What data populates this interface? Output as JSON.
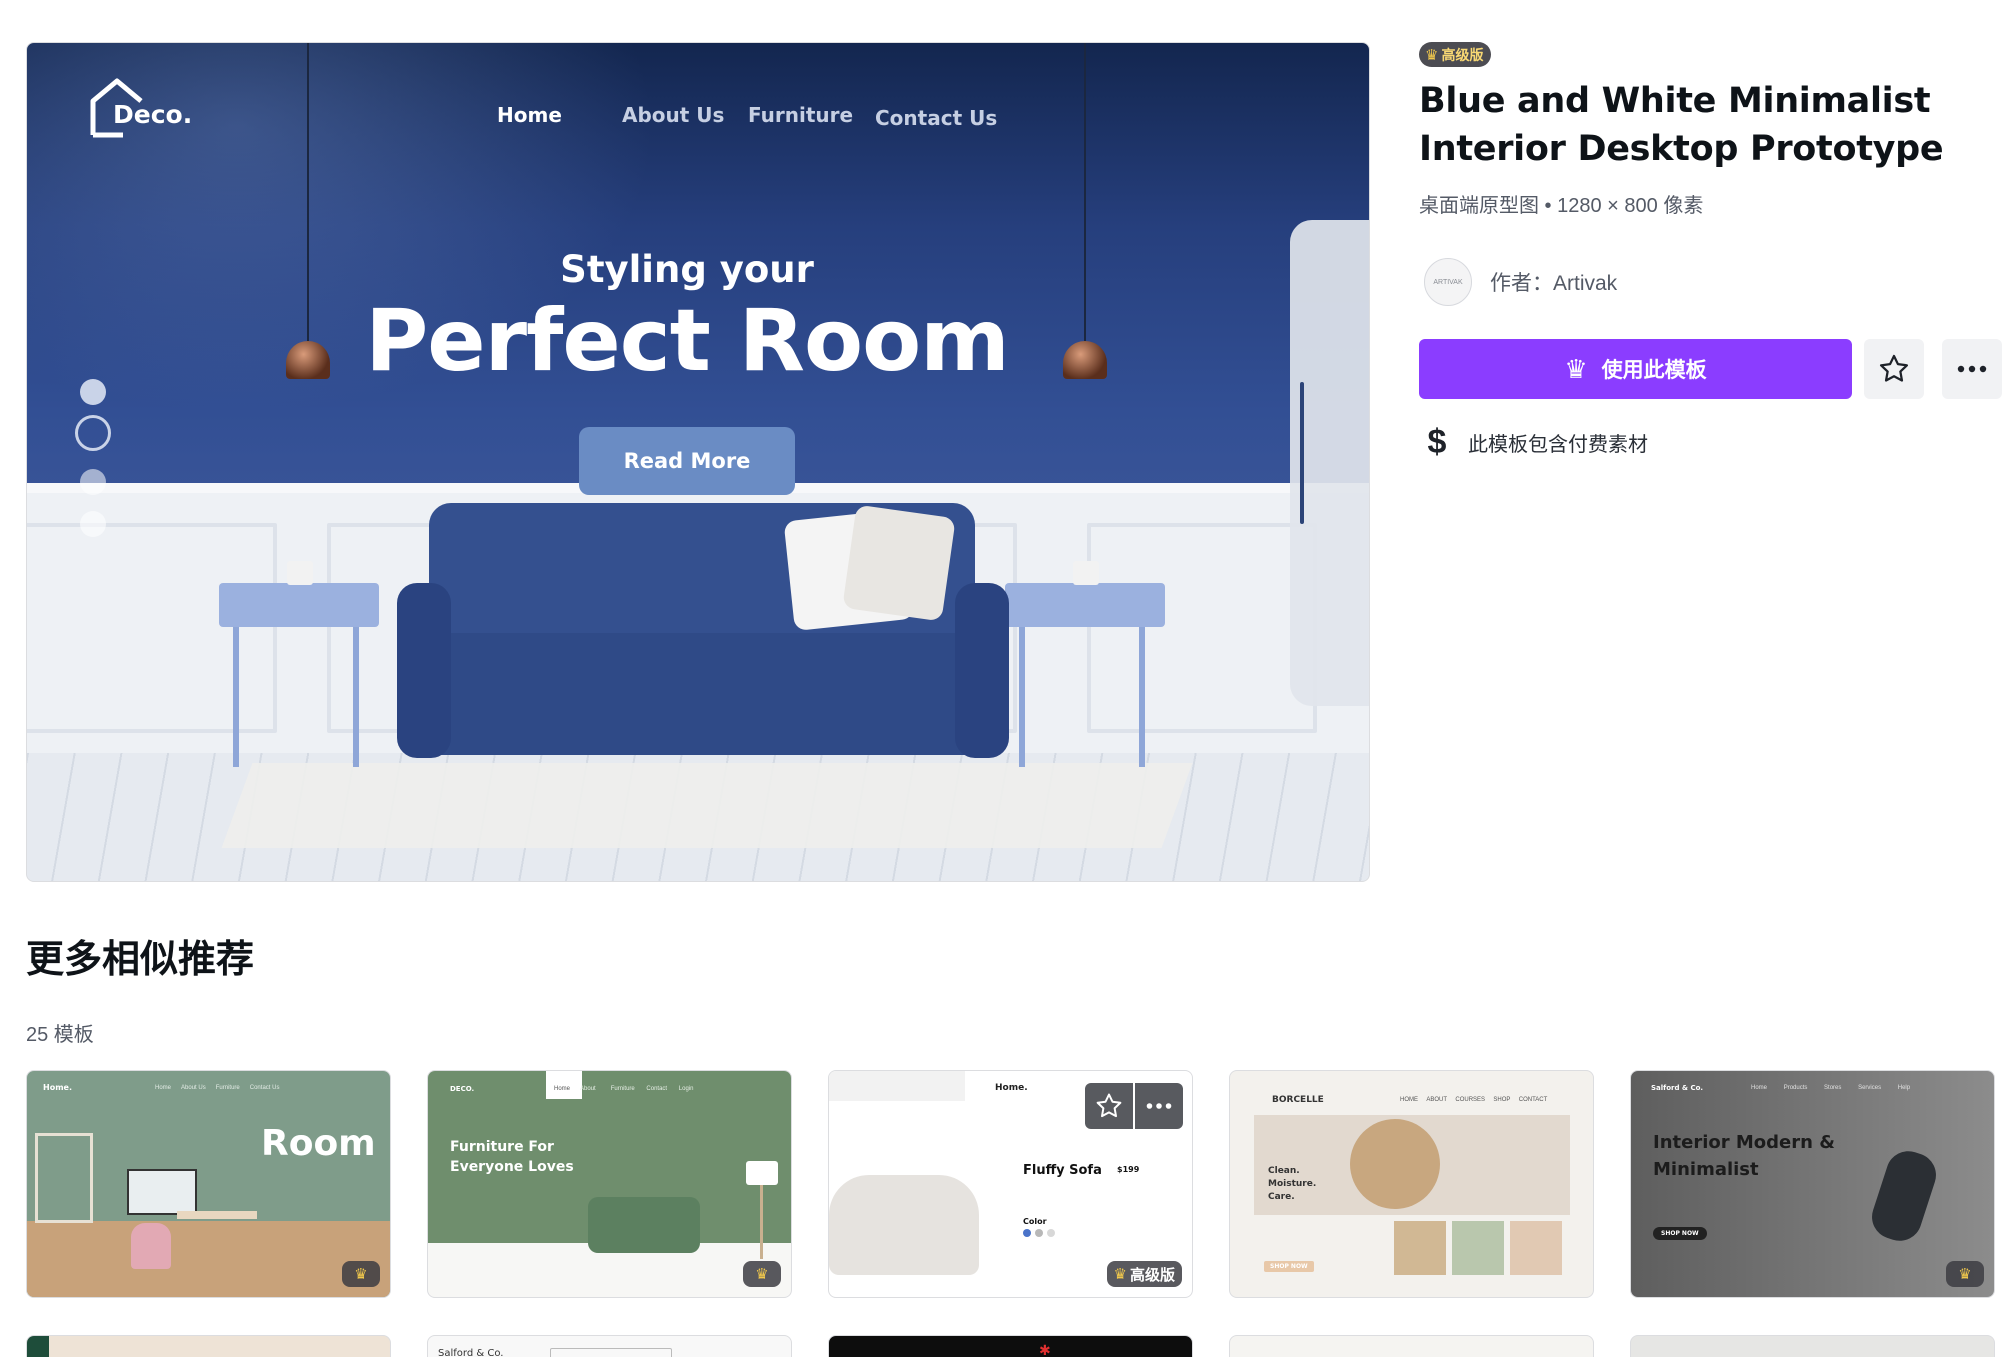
{
  "preview": {
    "logo_text": "Deco.",
    "nav": [
      "Home",
      "About Us",
      "Furniture",
      "Contact Us"
    ],
    "subtitle": "Styling your",
    "headline": "Perfect Room",
    "cta": "Read More"
  },
  "template": {
    "badge": "高级版",
    "title": "Blue and White Minimalist Interior Desktop Prototype",
    "meta": "桌面端原型图 • 1280 × 800 像素",
    "avatar_text": "ARTIVAK",
    "author": "作者：Artivak",
    "use_button": "使用此模板",
    "paid_note": "此模板包含付费素材"
  },
  "icons": {
    "badge": "crown-icon",
    "use_button": "crown-icon",
    "favorite": "star-icon",
    "more": "more-dots-icon",
    "paid": "dollar-icon"
  },
  "colors": {
    "accent": "#8b3dff",
    "premium_gold": "#f2c94c",
    "hero_blue": "#324f94"
  },
  "recommendations": {
    "title": "更多相似推荐",
    "count": "25 模板",
    "cards": [
      {
        "logo": "Home.",
        "headline": "Room",
        "nav": [
          "Home",
          "About Us",
          "Furniture",
          "Contact Us"
        ],
        "badge": "crown"
      },
      {
        "logo": "DECO.",
        "headline": "Furniture For Everyone Loves",
        "nav": [
          "Home",
          "About",
          "Furniture",
          "Contact",
          "Login"
        ],
        "badge": "crown"
      },
      {
        "logo": "Home.",
        "headline": "Fluffy Sofa",
        "price": "$199",
        "label": "Color",
        "badge": "高级版"
      },
      {
        "logo": "BORCELLE",
        "headline": "Clean. Moisture. Care.",
        "nav": [
          "HOME",
          "ABOUT",
          "COURSES",
          "SHOP",
          "CONTACT"
        ],
        "cta": "SHOP NOW",
        "badge": ""
      },
      {
        "logo": "Salford & Co.",
        "headline": "Interior Modern & Minimalist",
        "nav": [
          "Home",
          "Products",
          "Stores",
          "Services",
          "Help"
        ],
        "cta": "SHOP NOW",
        "badge": "crown"
      }
    ],
    "row2": [
      {
        "logo": ""
      },
      {
        "logo": "Salford & Co."
      },
      {
        "logo": ""
      },
      {
        "logo": ""
      },
      {
        "logo": ""
      }
    ]
  }
}
